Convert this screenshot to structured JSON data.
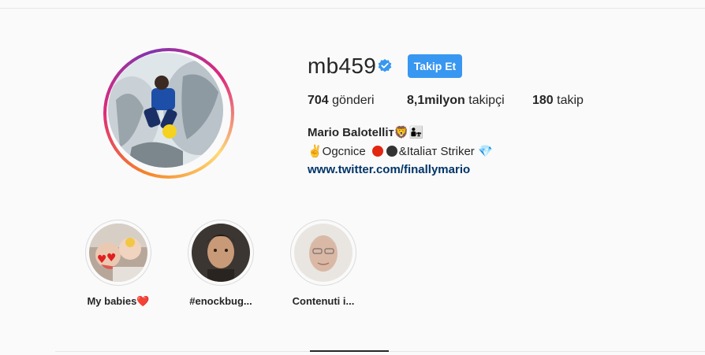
{
  "profile": {
    "username": "mb459",
    "follow_label": "Takip Et",
    "stats": {
      "posts_count": "704",
      "posts_label": "gönderi",
      "followers_count": "8,1milyon",
      "followers_label": "takipçi",
      "following_count": "180",
      "following_label": "takip"
    },
    "bio": {
      "name": "Mario Balotelliт🦁👨‍👧",
      "line_prefix": "✌️Ogcnice",
      "line_suffix": "&Italiaт Striker 💎",
      "link": "www.twitter.com/finallymario"
    }
  },
  "highlights": [
    {
      "label": "My babies❤️"
    },
    {
      "label": "#enockbug..."
    },
    {
      "label": "Contenuti i..."
    }
  ],
  "colors": {
    "follow_button": "#3897f0",
    "verified_badge": "#3897f0",
    "link": "#003569",
    "dot_red": "#e2260f",
    "dot_black": "#333333"
  },
  "icons": [
    "verified-badge-icon"
  ]
}
